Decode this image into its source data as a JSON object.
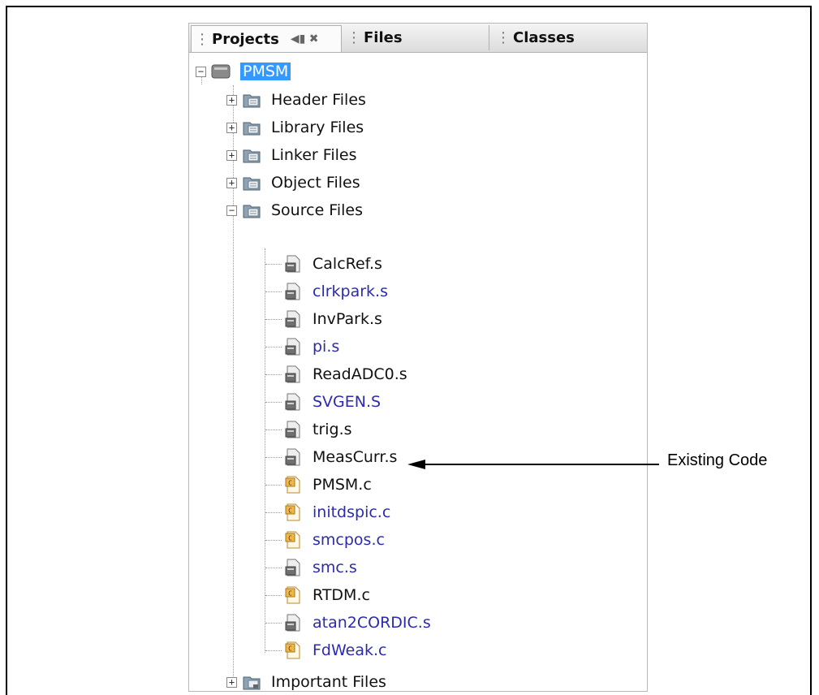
{
  "tabs": {
    "projects": "Projects",
    "files": "Files",
    "classes": "Classes"
  },
  "tree": {
    "root": "PMSM",
    "folders": [
      "Header Files",
      "Library Files",
      "Linker Files",
      "Object Files",
      "Source Files"
    ],
    "source_files": [
      {
        "name": "CalcRef.s",
        "type": "asm",
        "blue": false
      },
      {
        "name": "clrkpark.s",
        "type": "asm",
        "blue": true
      },
      {
        "name": "InvPark.s",
        "type": "asm",
        "blue": false
      },
      {
        "name": "pi.s",
        "type": "asm",
        "blue": true
      },
      {
        "name": "ReadADC0.s",
        "type": "asm",
        "blue": false
      },
      {
        "name": "SVGEN.S",
        "type": "asm",
        "blue": true
      },
      {
        "name": "trig.s",
        "type": "asm",
        "blue": false
      },
      {
        "name": "MeasCurr.s",
        "type": "asm",
        "blue": false
      },
      {
        "name": "PMSM.c",
        "type": "c",
        "blue": false
      },
      {
        "name": "initdspic.c",
        "type": "c",
        "blue": true
      },
      {
        "name": "smcpos.c",
        "type": "c",
        "blue": true
      },
      {
        "name": "smc.s",
        "type": "asm",
        "blue": true
      },
      {
        "name": "RTDM.c",
        "type": "c",
        "blue": false
      },
      {
        "name": "atan2CORDIC.s",
        "type": "asm",
        "blue": true
      },
      {
        "name": "FdWeak.c",
        "type": "c",
        "blue": true
      }
    ],
    "important": "Important Files"
  },
  "annotation": {
    "label": "Existing Code"
  },
  "colors": {
    "selected": "#3399ff",
    "link_blue": "#2b2bb0"
  },
  "icons": {
    "tab_menu": "restore-icon",
    "tab_close": "close-icon",
    "project": "project-icon",
    "folder": "folder-icon",
    "asm_file": "asm-file-icon",
    "c_file": "c-file-icon"
  }
}
